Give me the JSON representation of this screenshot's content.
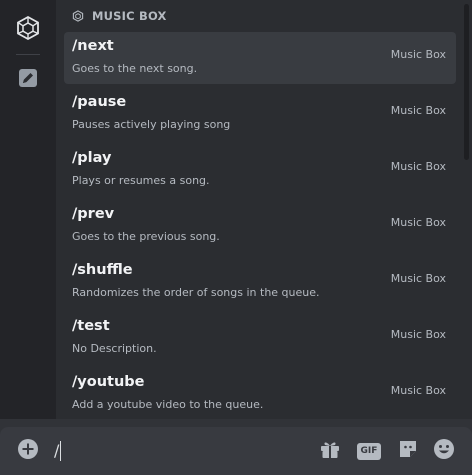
{
  "section": {
    "title": "MUSIC BOX",
    "icon": "music-box-app-icon"
  },
  "sidebar": {
    "items": [
      {
        "icon": "music-box-app-icon",
        "active": true
      },
      {
        "icon": "pencil-icon",
        "active": false
      }
    ]
  },
  "commands": [
    {
      "name": "/next",
      "description": "Goes to the next song.",
      "source": "Music Box",
      "selected": true
    },
    {
      "name": "/pause",
      "description": "Pauses actively playing song",
      "source": "Music Box",
      "selected": false
    },
    {
      "name": "/play",
      "description": "Plays or resumes a song.",
      "source": "Music Box",
      "selected": false
    },
    {
      "name": "/prev",
      "description": "Goes to the previous song.",
      "source": "Music Box",
      "selected": false
    },
    {
      "name": "/shuffle",
      "description": "Randomizes the order of songs in the queue.",
      "source": "Music Box",
      "selected": false
    },
    {
      "name": "/test",
      "description": "No Description.",
      "source": "Music Box",
      "selected": false
    },
    {
      "name": "/youtube",
      "description": "Add a youtube video to the queue.",
      "source": "Music Box",
      "selected": false
    }
  ],
  "chat_input": {
    "value": "/",
    "gif_label": "GIF"
  },
  "colors": {
    "background": "#313338",
    "popup": "#2b2d31",
    "rail": "#232428",
    "selected_row": "#393c41",
    "input": "#383a40"
  }
}
